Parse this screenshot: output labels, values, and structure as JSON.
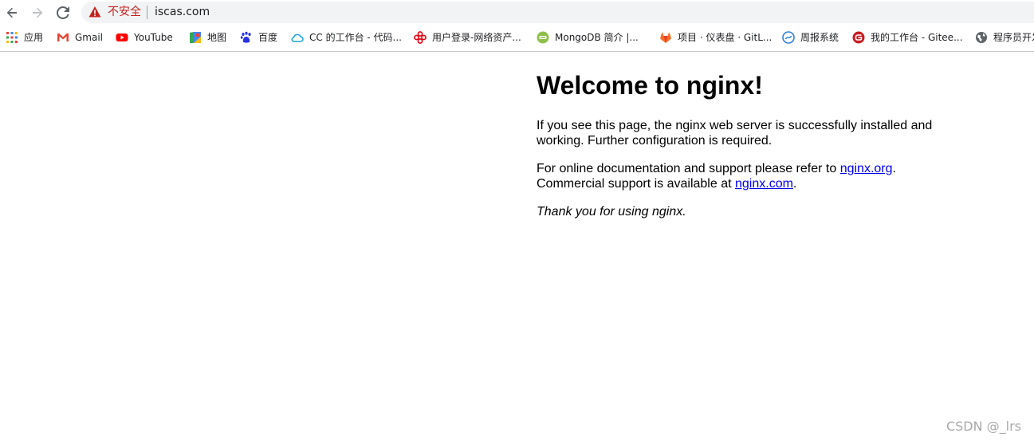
{
  "browser": {
    "insecure_label": "不安全",
    "url": "iscas.com"
  },
  "bookmarks": [
    {
      "label": "应用",
      "icon": "apps-grid-icon"
    },
    {
      "label": "Gmail",
      "icon": "gmail-icon"
    },
    {
      "label": "YouTube",
      "icon": "youtube-icon"
    },
    {
      "label": "地图",
      "icon": "maps-icon"
    },
    {
      "label": "百度",
      "icon": "baidu-icon"
    },
    {
      "label": "CC 的工作台 - 代码...",
      "icon": "cloud-icon"
    },
    {
      "label": "用户登录-网络资产...",
      "icon": "unicom-icon"
    },
    {
      "label": "MongoDB 简介 |...",
      "icon": "mongodb-icon"
    },
    {
      "label": "项目 · 仪表盘 · GitL...",
      "icon": "gitlab-icon"
    },
    {
      "label": "周报系统",
      "icon": "report-icon"
    },
    {
      "label": "我的工作台 - Gitee...",
      "icon": "gitee-icon"
    },
    {
      "label": "程序员开发",
      "icon": "globe-icon"
    }
  ],
  "page": {
    "heading": "Welcome to nginx!",
    "para1": "If you see this page, the nginx web server is successfully installed and working. Further configuration is required.",
    "para2_text1": "For online documentation and support please refer to ",
    "para2_link1": "nginx.org",
    "para2_text2": ".",
    "para2_text3": "Commercial support is available at ",
    "para2_link2": "nginx.com",
    "para2_text4": ".",
    "para3": "Thank you for using nginx."
  },
  "watermark": "CSDN @_lrs",
  "colors": {
    "insecure": "#c5221f",
    "link": "#0000ee"
  }
}
